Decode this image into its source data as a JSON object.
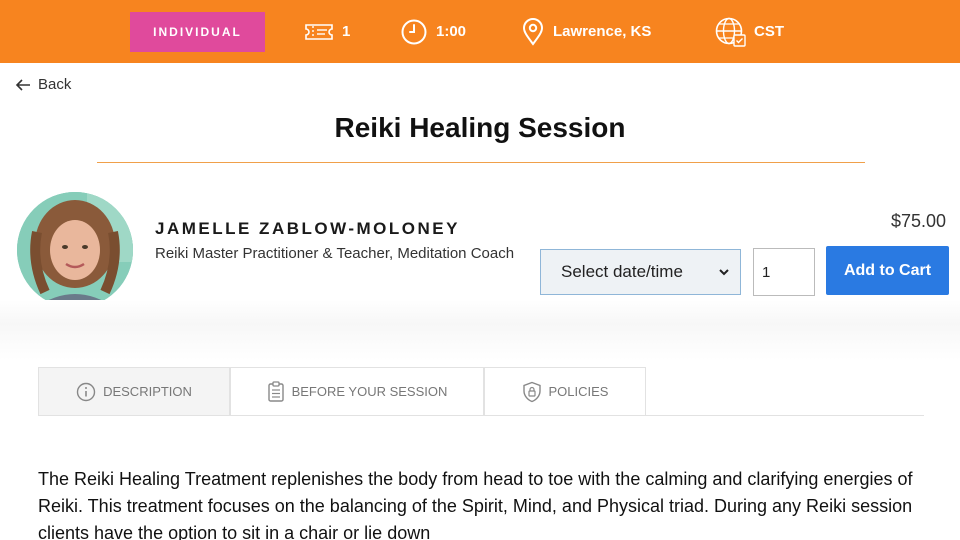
{
  "topbar": {
    "badge": "INDIVIDUAL",
    "tickets": "1",
    "duration": "1:00",
    "location": "Lawrence, KS",
    "timezone": "CST",
    "color": "#f7841f",
    "badge_color": "#e04a9c"
  },
  "nav": {
    "back_label": "Back"
  },
  "page": {
    "title": "Reiki Healing Session"
  },
  "practitioner": {
    "name": "JAMELLE ZABLOW-MOLONEY",
    "role": "Reiki Master Practitioner & Teacher, Meditation Coach"
  },
  "purchase": {
    "price": "$75.00",
    "select_value": "Select date/time",
    "quantity": "1",
    "add_to_cart": "Add to Cart",
    "button_color": "#2a7ae2"
  },
  "tabs": [
    {
      "label": "DESCRIPTION",
      "icon": "info-icon"
    },
    {
      "label": "BEFORE YOUR SESSION",
      "icon": "clipboard-icon"
    },
    {
      "label": "POLICIES",
      "icon": "shield-lock-icon"
    }
  ],
  "description": "The Reiki Healing Treatment replenishes the body from head to toe with the calming and clarifying energies of Reiki. This treatment focuses on the balancing of the Spirit, Mind, and Physical triad. During any Reiki session clients have the option to sit in a chair or lie down"
}
